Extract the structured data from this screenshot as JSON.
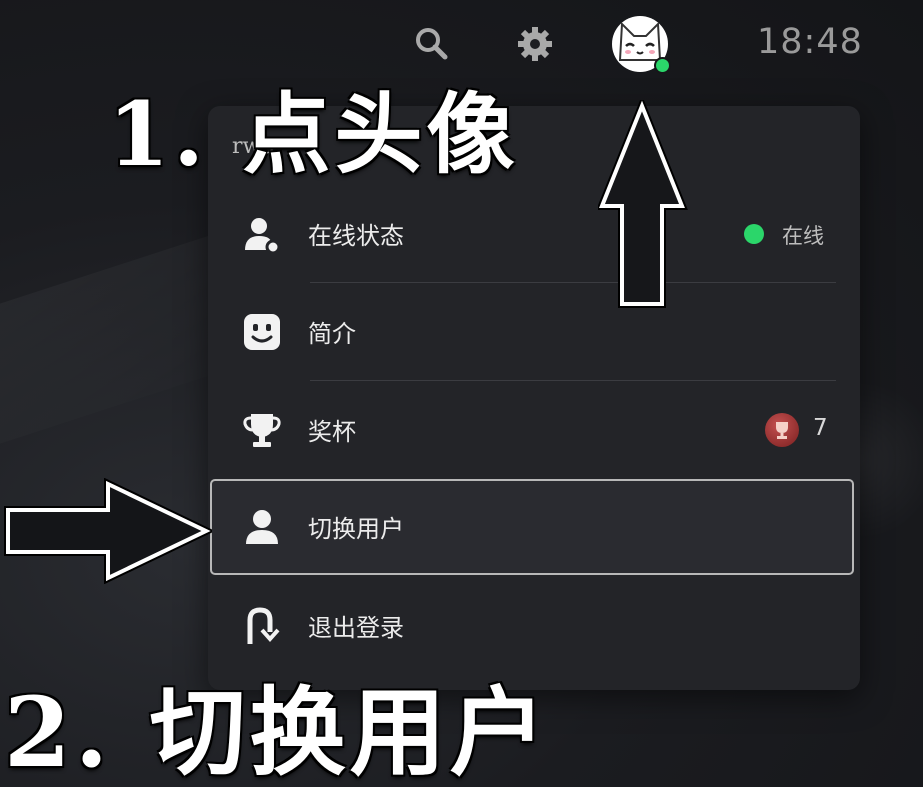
{
  "topbar": {
    "icons": [
      "search-icon",
      "gear-icon"
    ],
    "time": "18:48"
  },
  "profile": {
    "username": "rwu"
  },
  "menu": {
    "items": [
      {
        "label": "在线状态",
        "icon": "presence-icon",
        "status_text": "在线",
        "status_color": "#2bd66a"
      },
      {
        "label": "简介",
        "icon": "face-icon"
      },
      {
        "label": "奖杯",
        "icon": "trophy-icon",
        "count": "7"
      },
      {
        "label": "切换用户",
        "icon": "user-icon",
        "selected": true
      },
      {
        "label": "退出登录",
        "icon": "logout-icon"
      }
    ]
  },
  "annotations": {
    "step1": "1. 点头像",
    "step2": "2. 切换用户"
  },
  "colors": {
    "online": "#2bd66a",
    "panel": "#232428",
    "background": "#1b1c20"
  }
}
